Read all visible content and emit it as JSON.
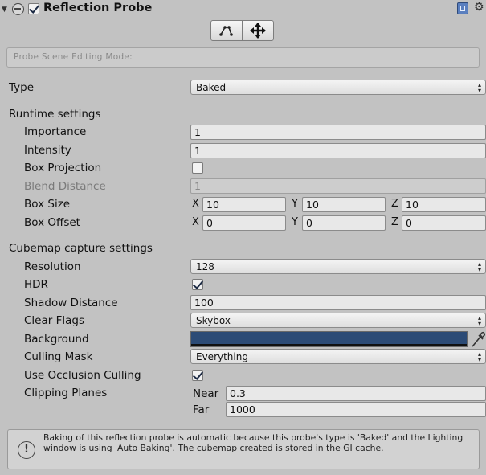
{
  "header": {
    "title": "Reflection Probe",
    "enabled": true,
    "edit_bounds_icon": "edit-bounds-icon",
    "move_icon": "move-origin-icon"
  },
  "mode_label": "Probe Scene Editing Mode:",
  "type": {
    "label": "Type",
    "value": "Baked"
  },
  "runtime": {
    "section": "Runtime settings",
    "importance": {
      "label": "Importance",
      "value": "1"
    },
    "intensity": {
      "label": "Intensity",
      "value": "1"
    },
    "box_projection": {
      "label": "Box Projection",
      "checked": false
    },
    "blend_distance": {
      "label": "Blend Distance",
      "value": "1"
    },
    "box_size": {
      "label": "Box Size",
      "x": "10",
      "y": "10",
      "z": "10"
    },
    "box_offset": {
      "label": "Box Offset",
      "x": "0",
      "y": "0",
      "z": "0"
    }
  },
  "axes": {
    "x": "X",
    "y": "Y",
    "z": "Z"
  },
  "cubemap": {
    "section": "Cubemap capture settings",
    "resolution": {
      "label": "Resolution",
      "value": "128"
    },
    "hdr": {
      "label": "HDR",
      "checked": true
    },
    "shadow_distance": {
      "label": "Shadow Distance",
      "value": "100"
    },
    "clear_flags": {
      "label": "Clear Flags",
      "value": "Skybox"
    },
    "background": {
      "label": "Background",
      "color": "#2c4b76"
    },
    "culling_mask": {
      "label": "Culling Mask",
      "value": "Everything"
    },
    "occlusion": {
      "label": "Use Occlusion Culling",
      "checked": true
    },
    "clipping": {
      "label": "Clipping Planes",
      "near_label": "Near",
      "near": "0.3",
      "far_label": "Far",
      "far": "1000"
    }
  },
  "info": "Baking of this reflection probe is automatic because this probe's type is 'Baked' and the Lighting window is using 'Auto Baking'. The cubemap created is stored in the GI cache."
}
